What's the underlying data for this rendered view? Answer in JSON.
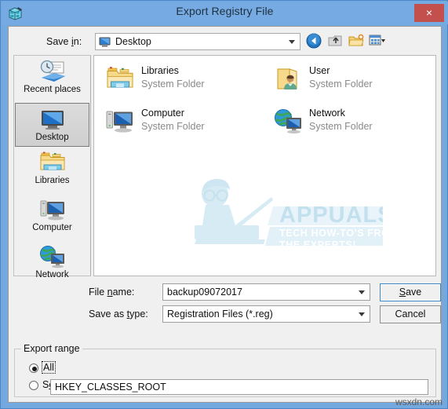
{
  "window": {
    "title": "Export Registry File",
    "app_icon": "registry-editor-icon",
    "close_label": "×",
    "titlebar_color": "#76aae2",
    "close_color": "#c3504d",
    "frame_color": "#74a9e0"
  },
  "savein": {
    "label": "Save in:",
    "value": "Desktop",
    "icon": "desktop-icon"
  },
  "toolbar": {
    "buttons": [
      {
        "name": "back-button",
        "icon": "back-arrow-icon"
      },
      {
        "name": "up-one-level-button",
        "icon": "up-folder-icon"
      },
      {
        "name": "new-folder-button",
        "icon": "new-folder-icon"
      },
      {
        "name": "views-button",
        "icon": "views-grid-icon"
      }
    ]
  },
  "places": {
    "items": [
      {
        "label": "Recent places",
        "icon": "recent-places-icon",
        "selected": false
      },
      {
        "label": "Desktop",
        "icon": "desktop-icon",
        "selected": true
      },
      {
        "label": "Libraries",
        "icon": "libraries-folder-icon",
        "selected": false
      },
      {
        "label": "Computer",
        "icon": "computer-icon",
        "selected": false
      },
      {
        "label": "Network",
        "icon": "network-globe-icon",
        "selected": false
      }
    ]
  },
  "filelist": {
    "items": [
      {
        "name": "Libraries",
        "type": "System Folder",
        "icon": "libraries-folder-icon"
      },
      {
        "name": "User",
        "type": "System Folder",
        "icon": "user-folder-icon"
      },
      {
        "name": "Computer",
        "type": "System Folder",
        "icon": "computer-icon"
      },
      {
        "name": "Network",
        "type": "System Folder",
        "icon": "network-globe-icon"
      }
    ]
  },
  "watermark": {
    "brand": "APPUALS",
    "tagline_line1": "TECH HOW-TO'S FROM",
    "tagline_line2": "THE EXPERTS!",
    "color": "#8fc3e0"
  },
  "filename": {
    "label": "File name:",
    "value": "backup09072017"
  },
  "filetype": {
    "label": "Save as type:",
    "value": "Registration Files (*.reg)"
  },
  "buttons": {
    "save": "Save",
    "cancel": "Cancel"
  },
  "export_range": {
    "legend": "Export range",
    "options": [
      {
        "label": "All",
        "selected": true,
        "focused": true
      },
      {
        "label": "Selected branch",
        "selected": false,
        "focused": false
      }
    ],
    "branch_value": "HKEY_CLASSES_ROOT"
  },
  "site_watermark": "wsxdn.com"
}
